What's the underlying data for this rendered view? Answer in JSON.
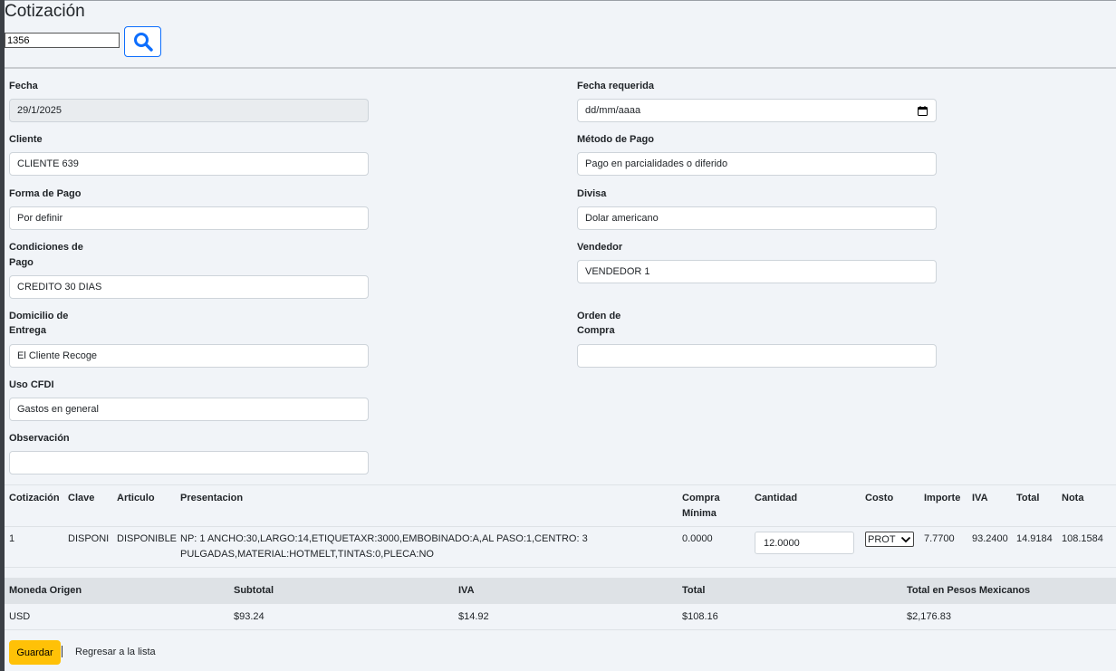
{
  "page": {
    "title": "Cotización"
  },
  "search": {
    "value": "1356"
  },
  "form": {
    "fecha": {
      "label": "Fecha",
      "value": "29/1/2025"
    },
    "fecha_requerida": {
      "label": "Fecha requerida",
      "placeholder": "dd/mm/aaaa"
    },
    "cliente": {
      "label": "Cliente",
      "value": "CLIENTE 639"
    },
    "metodo_pago": {
      "label": "Método de Pago",
      "value": "Pago en parcialidades o diferido"
    },
    "forma_pago": {
      "label": "Forma de Pago",
      "value": "Por definir"
    },
    "divisa": {
      "label": "Divisa",
      "value": "Dolar americano"
    },
    "condiciones_pago": {
      "label_line1": "Condiciones de",
      "label_line2": "Pago",
      "value": "CREDITO 30 DIAS"
    },
    "vendedor": {
      "label": "Vendedor",
      "value": "VENDEDOR 1"
    },
    "domicilio_entrega": {
      "label_line1": "Domicilio de",
      "label_line2": "Entrega",
      "value": "El Cliente Recoge"
    },
    "orden_compra": {
      "label_line1": "Orden de",
      "label_line2": "Compra",
      "value": ""
    },
    "uso_cfdi": {
      "label": "Uso CFDI",
      "value": "Gastos en general"
    },
    "observacion": {
      "label": "Observación",
      "value": ""
    }
  },
  "items_table": {
    "headers": {
      "cotizacion": "Cotización",
      "clave": "Clave",
      "articulo": "Articulo",
      "presentacion": "Presentacion",
      "compra_minima_1": "Compra",
      "compra_minima_2": "Mínima",
      "cantidad": "Cantidad",
      "costo": "Costo",
      "importe": "Importe",
      "iva": "IVA",
      "total": "Total",
      "nota": "Nota"
    },
    "rows": [
      {
        "cotizacion": "1",
        "clave": "DISPONI",
        "articulo": "DISPONIBLE",
        "presentacion_1": "NP: 1 ANCHO:30,LARGO:14,ETIQUETAXR:3000,EMBOBINADO:A,AL PASO:1,CENTRO: 3",
        "presentacion_2": "PULGADAS,MATERIAL:HOTMELT,TINTAS:0,PLECA:NO",
        "compra_minima": "0.0000",
        "cantidad": "12.0000",
        "costo": "PROT",
        "importe": "7.7700",
        "iva": "93.2400",
        "total": "14.9184",
        "nota": "108.1584"
      }
    ]
  },
  "totals": {
    "headers": {
      "moneda": "Moneda Origen",
      "subtotal": "Subtotal",
      "iva": "IVA",
      "total": "Total",
      "total_mxn": "Total en Pesos Mexicanos"
    },
    "values": {
      "moneda": "USD",
      "subtotal": "$93.24",
      "iva": "$14.92",
      "total": "$108.16",
      "total_mxn": "$2,176.83"
    }
  },
  "actions": {
    "save_label": "Guardar",
    "back_label": "Regresar a la lista"
  },
  "colors": {
    "primary": "#0d6efd",
    "warning": "#ffc107",
    "background": "#f1f4f8"
  }
}
